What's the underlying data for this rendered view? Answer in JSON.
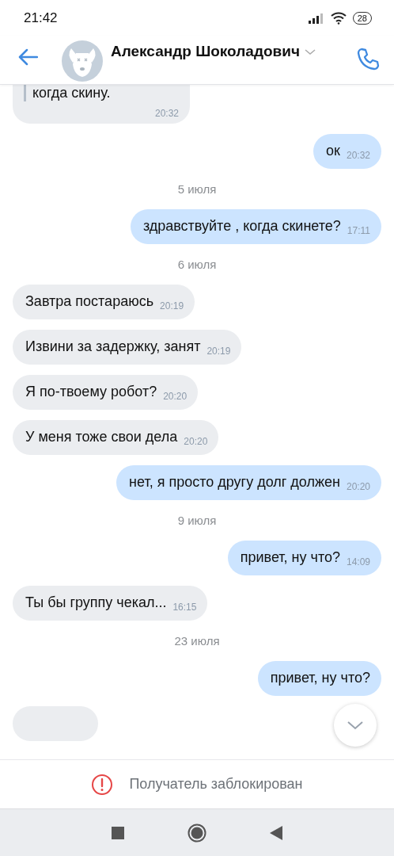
{
  "status_bar": {
    "time": "21:42",
    "battery": "28"
  },
  "header": {
    "name": "Александр Шоколадович"
  },
  "messages": [
    {
      "kind": "message",
      "outgoing": false,
      "quote": true,
      "text": "когда скину.",
      "time": "20:32"
    },
    {
      "kind": "message",
      "outgoing": true,
      "text": "ок",
      "time": "20:32"
    },
    {
      "kind": "date",
      "text": "5 июля"
    },
    {
      "kind": "message",
      "outgoing": true,
      "text": "здравствуйте , когда скинете?",
      "time": "17:11"
    },
    {
      "kind": "date",
      "text": "6 июля"
    },
    {
      "kind": "message",
      "outgoing": false,
      "text": "Завтра постараюсь",
      "time": "20:19"
    },
    {
      "kind": "message",
      "outgoing": false,
      "text": "Извини за задержку, занят",
      "time": "20:19"
    },
    {
      "kind": "message",
      "outgoing": false,
      "text": "Я по-твоему робот?",
      "time": "20:20"
    },
    {
      "kind": "message",
      "outgoing": false,
      "text": "У меня тоже свои дела",
      "time": "20:20"
    },
    {
      "kind": "message",
      "outgoing": true,
      "text": "нет, я просто другу долг должен",
      "time": "20:20"
    },
    {
      "kind": "date",
      "text": "9 июля"
    },
    {
      "kind": "message",
      "outgoing": true,
      "text": "привет, ну что?",
      "time": "14:09"
    },
    {
      "kind": "message",
      "outgoing": false,
      "text": "Ты бы группу чекал...",
      "time": "16:15"
    },
    {
      "kind": "date",
      "text": "23 июля"
    },
    {
      "kind": "message",
      "outgoing": true,
      "text": "привет, ну что?"
    },
    {
      "kind": "cut",
      "outgoing": false
    }
  ],
  "footer": {
    "notice": "Получатель заблокирован"
  }
}
